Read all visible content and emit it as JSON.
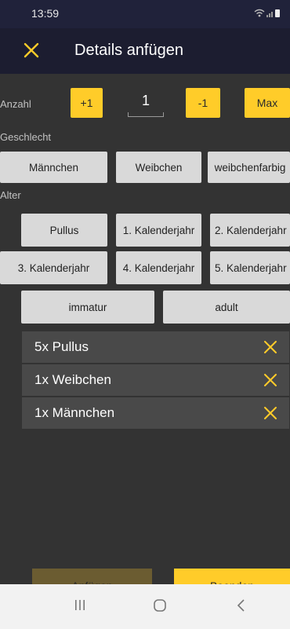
{
  "status": {
    "time": "13:59"
  },
  "header": {
    "title": "Details anfügen",
    "close_icon": "close-icon"
  },
  "count": {
    "label": "Anzahl",
    "plus_label": "+1",
    "value": "1",
    "minus_label": "-1",
    "max_label": "Max"
  },
  "gender": {
    "label": "Geschlecht",
    "options": [
      "Männchen",
      "Weibchen",
      "weibchenfarbig"
    ]
  },
  "age": {
    "label": "Alter",
    "options": [
      "Pullus",
      "1. Kalenderjahr",
      "2. Kalenderjahr",
      "3. Kalenderjahr",
      "4. Kalenderjahr",
      "5. Kalenderjahr",
      "immatur",
      "adult"
    ]
  },
  "list": {
    "items": [
      "5x Pullus",
      "1x Weibchen",
      "1x Männchen"
    ]
  },
  "actions": {
    "append_label": "Anfügen",
    "finish_label": "Beenden"
  },
  "colors": {
    "accent": "#ffcc29",
    "app_bar": "#1c1d30",
    "background": "#333333",
    "list_item": "#494949",
    "disabled_button": "#6b5c31"
  }
}
